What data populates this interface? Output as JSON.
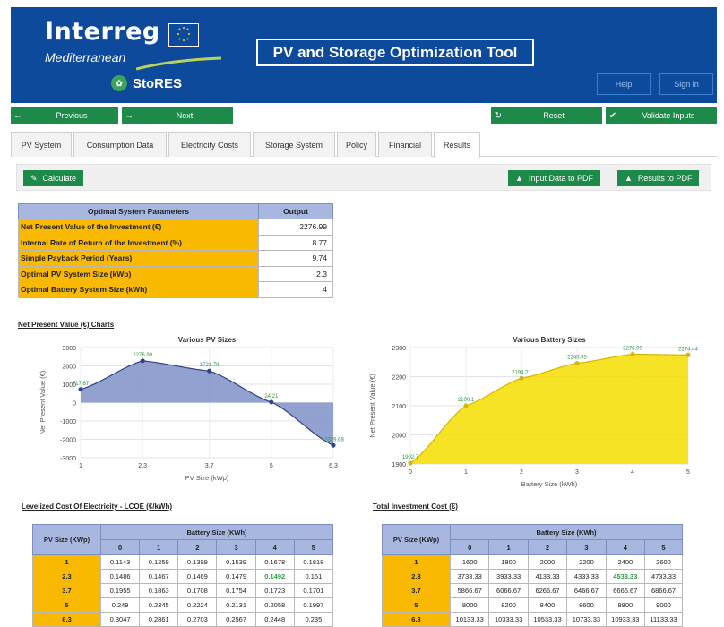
{
  "header": {
    "logo_main": "Interreg",
    "logo_sub": "Mediterranean",
    "logo_project": "StoRES",
    "app_title": "PV and Storage Optimization Tool",
    "help_label": "Help",
    "signin_label": "Sign in"
  },
  "nav": {
    "previous": "Previous",
    "next": "Next",
    "reset": "Reset",
    "validate": "Validate Inputs"
  },
  "tabs": [
    "PV System",
    "Consumption Data",
    "Electricity Costs",
    "Storage System",
    "Policy",
    "Financial",
    "Results"
  ],
  "toolbar": {
    "calculate": "Calculate",
    "input_pdf": "Input Data to PDF",
    "results_pdf": "Results to PDF"
  },
  "optimal": {
    "col1": "Optimal System Parameters",
    "col2": "Output",
    "rows": [
      {
        "label": "Net Present Value of the Investment (€)",
        "value": "2276.99"
      },
      {
        "label": "Internal Rate of Return of the Investment (%)",
        "value": "8.77"
      },
      {
        "label": "Simple Payback Period (Years)",
        "value": "9.74"
      },
      {
        "label": "Optimal PV System Size (kWp)",
        "value": "2.3"
      },
      {
        "label": "Optimal Battery System Size (kWh)",
        "value": "4"
      }
    ]
  },
  "npv_section_title": "Net Present Value (€) Charts",
  "lcoe_section_title": "Levelized Cost Of Electricity - LCOE (€/kWh)",
  "tic_section_title": "Total Investment Cost (€)",
  "chart_data": [
    {
      "type": "area",
      "title": "Various PV Sizes",
      "xlabel": "PV Size (kWp)",
      "ylabel": "Net Present Value (€)",
      "x": [
        1,
        2.3,
        3.7,
        5,
        6.3
      ],
      "x_ticks": [
        "1",
        "2.3",
        "3.7",
        "5",
        "6.3"
      ],
      "ylim": [
        -3000,
        3000
      ],
      "y_ticks": [
        3000,
        2000,
        1000,
        0,
        -1000,
        -2000,
        -3000
      ],
      "points": [
        {
          "x": 1,
          "y": 717.67,
          "label": "717.67"
        },
        {
          "x": 2.3,
          "y": 2276.99,
          "label": "2276.99"
        },
        {
          "x": 3.7,
          "y": 1721.79,
          "label": "1721.79"
        },
        {
          "x": 5,
          "y": 24.21,
          "label": "24.21"
        },
        {
          "x": 6.3,
          "y": -2329.68,
          "label": "-2329.68"
        }
      ],
      "color": "#7f90c8",
      "line_color": "#2d4383"
    },
    {
      "type": "area",
      "title": "Various Battery Sizes",
      "xlabel": "Battery Size (kWh)",
      "ylabel": "Net Present Value (€)",
      "x": [
        0,
        1,
        2,
        3,
        4,
        5
      ],
      "x_ticks": [
        "0",
        "1",
        "2",
        "3",
        "4",
        "5"
      ],
      "ylim": [
        1900,
        2300
      ],
      "y_ticks": [
        2300,
        2200,
        2100,
        2000,
        1900
      ],
      "points": [
        {
          "x": 0,
          "y": 1902.7,
          "label": "1902.7"
        },
        {
          "x": 1,
          "y": 2100.1,
          "label": "2100.1"
        },
        {
          "x": 2,
          "y": 2194.21,
          "label": "2194.21"
        },
        {
          "x": 3,
          "y": 2245.95,
          "label": "2245.95"
        },
        {
          "x": 4,
          "y": 2276.99,
          "label": "2276.99"
        },
        {
          "x": 5,
          "y": 2274.44,
          "label": "2274.44"
        }
      ],
      "color": "#f5de00",
      "line_color": "#d9b400"
    }
  ],
  "lcoe_table": {
    "row_header": "PV Size (KWp)",
    "group_header": "Battery Size (KWh)",
    "cols": [
      "0",
      "1",
      "2",
      "3",
      "4",
      "5"
    ],
    "rows": [
      {
        "pv": "1",
        "vals": [
          "0.1143",
          "0.1259",
          "0.1399",
          "0.1539",
          "0.1678",
          "0.1818"
        ]
      },
      {
        "pv": "2.3",
        "vals": [
          "0.1486",
          "0.1467",
          "0.1469",
          "0.1479",
          "0.1492",
          "0.151"
        ]
      },
      {
        "pv": "3.7",
        "vals": [
          "0.1955",
          "0.1863",
          "0.1708",
          "0.1754",
          "0.1723",
          "0.1701"
        ]
      },
      {
        "pv": "5",
        "vals": [
          "0.249",
          "0.2345",
          "0.2224",
          "0.2131",
          "0.2058",
          "0.1997"
        ]
      },
      {
        "pv": "6.3",
        "vals": [
          "0.3047",
          "0.2861",
          "0.2703",
          "0.2567",
          "0.2448",
          "0.235"
        ]
      }
    ]
  },
  "tic_table": {
    "row_header": "PV Size (KWp)",
    "group_header": "Battery Size (KWh)",
    "cols": [
      "0",
      "1",
      "2",
      "3",
      "4",
      "5"
    ],
    "rows": [
      {
        "pv": "1",
        "vals": [
          "1600",
          "1800",
          "2000",
          "2200",
          "2400",
          "2600"
        ]
      },
      {
        "pv": "2.3",
        "vals": [
          "3733.33",
          "3933.33",
          "4133.33",
          "4333.33",
          "4533.33",
          "4733.33"
        ]
      },
      {
        "pv": "3.7",
        "vals": [
          "5866.67",
          "6066.67",
          "6266.67",
          "6466.67",
          "6666.67",
          "6866.67"
        ]
      },
      {
        "pv": "5",
        "vals": [
          "8000",
          "8200",
          "8400",
          "8600",
          "8800",
          "9000"
        ]
      },
      {
        "pv": "6.3",
        "vals": [
          "10133.33",
          "10333.33",
          "10533.33",
          "10733.33",
          "10933.33",
          "11133.33"
        ]
      }
    ]
  }
}
